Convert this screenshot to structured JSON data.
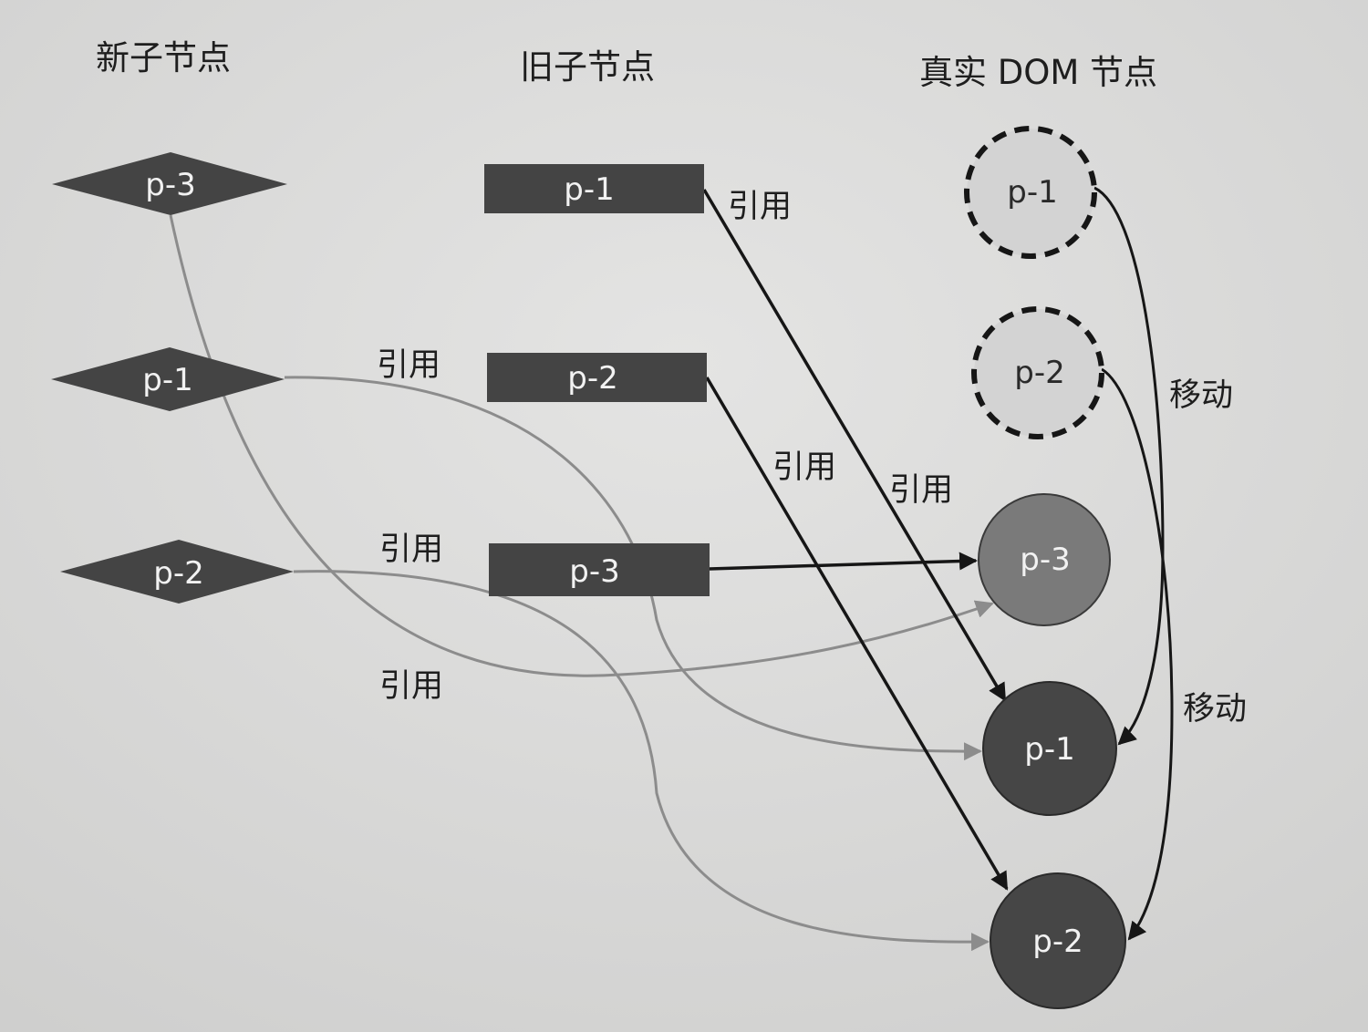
{
  "headings": {
    "new_children": "新子节点",
    "old_children": "旧子节点",
    "real_dom": "真实 DOM 节点"
  },
  "new_nodes": [
    "p-3",
    "p-1",
    "p-2"
  ],
  "old_nodes": [
    "p-1",
    "p-2",
    "p-3"
  ],
  "dom_removed_nodes": [
    "p-1",
    "p-2"
  ],
  "dom_nodes": [
    "p-3",
    "p-1",
    "p-2"
  ],
  "edge_labels": {
    "reference": "引用",
    "move": "移动"
  },
  "colors": {
    "background": "#dcdcdb",
    "node_dark": "#444444",
    "node_mid": "#7a7a7a",
    "ghost_fill": "#d3d3d3",
    "old_edge": "#161616",
    "new_edge": "#8c8c8c"
  }
}
